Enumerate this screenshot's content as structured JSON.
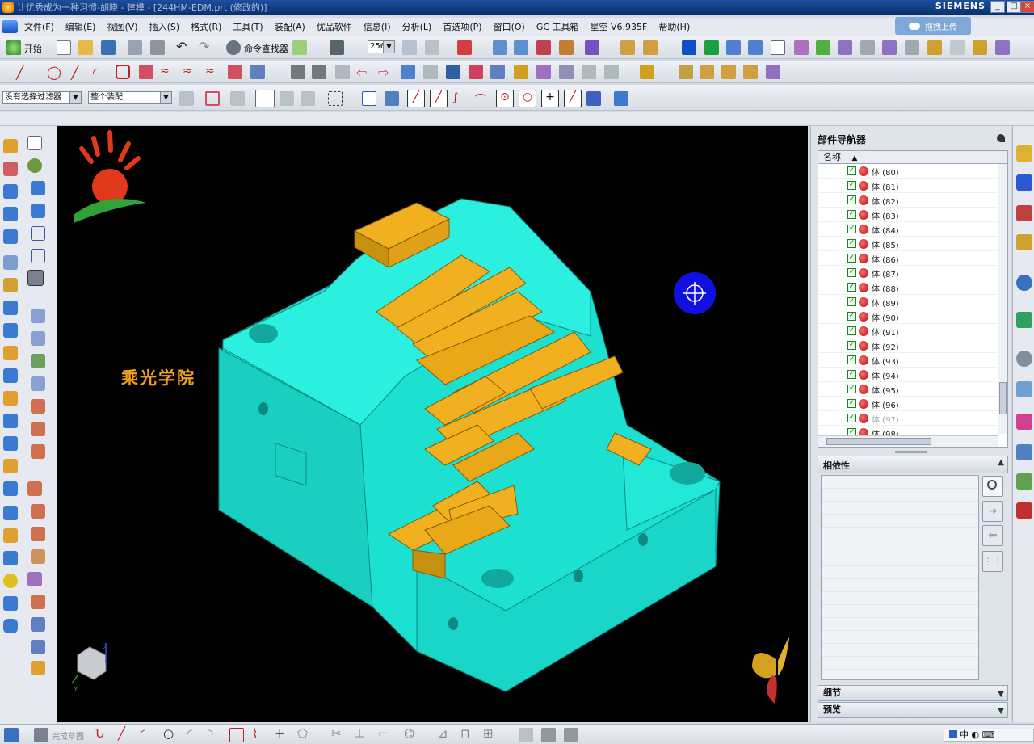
{
  "window": {
    "title": "让优秀成为一种习惯-胡晓 - 建模 - [244HM-EDM.prt (修改的)]",
    "brand": "SIEMENS",
    "minimize": "_",
    "restore": "□",
    "close": "×",
    "upload_button": "拖拽上传"
  },
  "menu": [
    "文件(F)",
    "编辑(E)",
    "视图(V)",
    "插入(S)",
    "格式(R)",
    "工具(T)",
    "装配(A)",
    "优品软件",
    "信息(I)",
    "分析(L)",
    "首选项(P)",
    "窗口(O)",
    "GC 工具箱",
    "星空 V6.935F",
    "帮助(H)"
  ],
  "toolbar1": {
    "start_label": "开始",
    "cmd_finder": "命令查找器",
    "color_count": "256"
  },
  "toolbar3": {
    "filter": "没有选择过滤器",
    "scope": "整个装配"
  },
  "viewport": {
    "logo_text": "乘光学院",
    "triad_y": "Y",
    "triad_z": "Z"
  },
  "part_navigator": {
    "title": "部件导航器",
    "column": "名称",
    "rows": [
      {
        "label": "体 (80)",
        "checked": true
      },
      {
        "label": "体 (81)",
        "checked": true
      },
      {
        "label": "体 (82)",
        "checked": true
      },
      {
        "label": "体 (83)",
        "checked": true
      },
      {
        "label": "体 (84)",
        "checked": true
      },
      {
        "label": "体 (85)",
        "checked": true
      },
      {
        "label": "体 (86)",
        "checked": true
      },
      {
        "label": "体 (87)",
        "checked": true
      },
      {
        "label": "体 (88)",
        "checked": true
      },
      {
        "label": "体 (89)",
        "checked": true
      },
      {
        "label": "体 (90)",
        "checked": true
      },
      {
        "label": "体 (91)",
        "checked": true
      },
      {
        "label": "体 (92)",
        "checked": true
      },
      {
        "label": "体 (93)",
        "checked": true
      },
      {
        "label": "体 (94)",
        "checked": true
      },
      {
        "label": "体 (95)",
        "checked": true
      },
      {
        "label": "体 (96)",
        "checked": true
      },
      {
        "label": "体 (97)",
        "checked": true,
        "dim": true
      },
      {
        "label": "体 (98)",
        "checked": true
      }
    ],
    "dependency": "相依性",
    "details": "细节",
    "preview": "预览"
  },
  "statusbar": {
    "sketch_done": "完成草图",
    "ime": "中"
  },
  "colors": {
    "model": "#1ce0d0",
    "electrodes": "#f0b020",
    "viewport_bg": "#000000",
    "view_cursor": "#1010e0"
  }
}
